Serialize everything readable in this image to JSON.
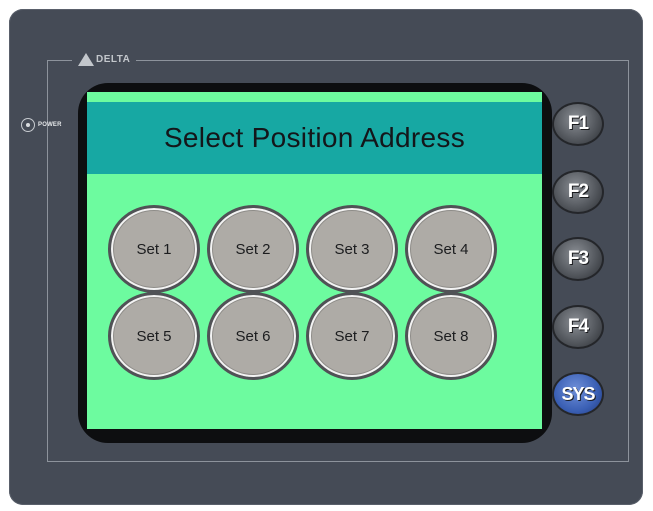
{
  "device": {
    "brand": "DELTA",
    "power_label": "POWER"
  },
  "screen": {
    "title": "Select Position Address",
    "colors": {
      "background": "#6dfb9f",
      "title_bar": "#17a8a3",
      "button_face": "#aeaba6"
    },
    "buttons": [
      {
        "label": "Set 1"
      },
      {
        "label": "Set 2"
      },
      {
        "label": "Set 3"
      },
      {
        "label": "Set 4"
      },
      {
        "label": "Set 5"
      },
      {
        "label": "Set 6"
      },
      {
        "label": "Set 7"
      },
      {
        "label": "Set 8"
      }
    ]
  },
  "function_keys": [
    {
      "label": "F1"
    },
    {
      "label": "F2"
    },
    {
      "label": "F3"
    },
    {
      "label": "F4"
    },
    {
      "label": "SYS"
    }
  ]
}
